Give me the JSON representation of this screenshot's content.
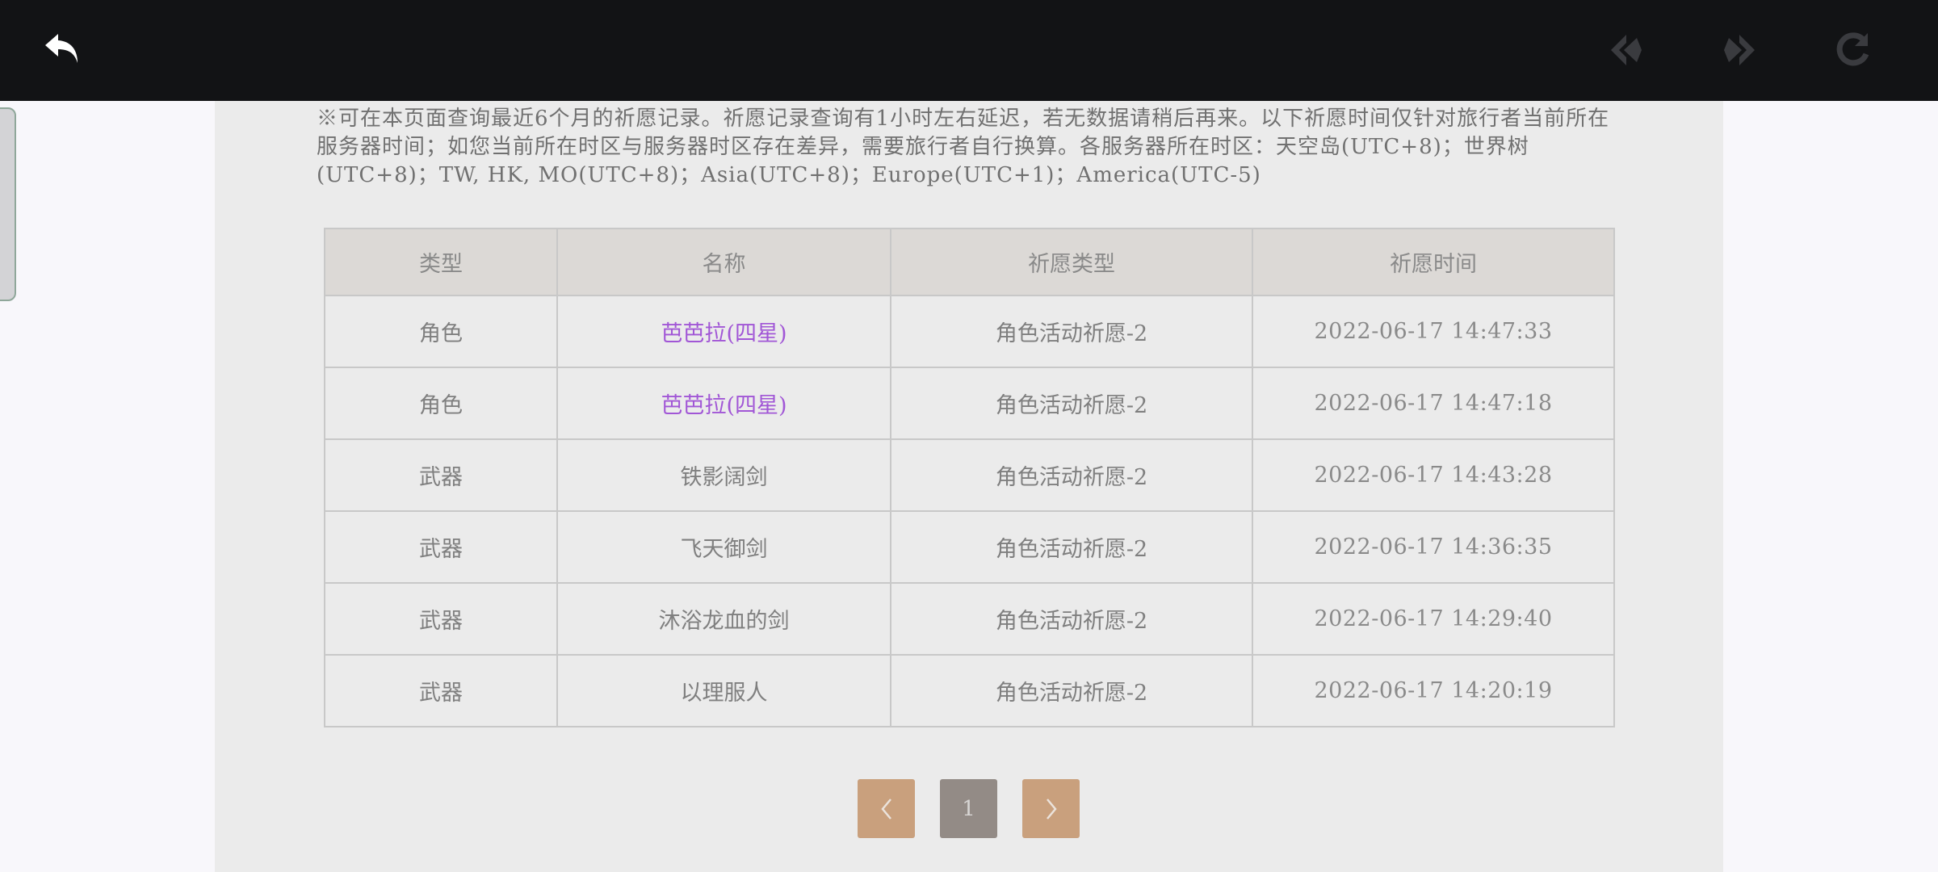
{
  "toolbar": {
    "back_icon": "back-arrow-icon",
    "prev_icon": "nav-back-diamond-icon",
    "next_icon": "nav-forward-diamond-icon",
    "refresh_icon": "refresh-icon"
  },
  "notice": "※可在本页面查询最近6个月的祈愿记录。祈愿记录查询有1小时左右延迟，若无数据请稍后再来。以下祈愿时间仅针对旅行者当前所在服务器时间；如您当前所在时区与服务器时区存在差异，需要旅行者自行换算。各服务器所在时区：天空岛(UTC+8)；世界树(UTC+8)；TW, HK, MO(UTC+8)；Asia(UTC+8)；Europe(UTC+1)；America(UTC-5)",
  "table": {
    "headers": [
      "类型",
      "名称",
      "祈愿类型",
      "祈愿时间"
    ],
    "rows": [
      {
        "type": "角色",
        "name": "芭芭拉(四星)",
        "wish": "角色活动祈愿-2",
        "time": "2022-06-17 14:47:33"
      },
      {
        "type": "角色",
        "name": "芭芭拉(四星)",
        "wish": "角色活动祈愿-2",
        "time": "2022-06-17 14:47:18"
      },
      {
        "type": "武器",
        "name": "铁影阔剑",
        "wish": "角色活动祈愿-2",
        "time": "2022-06-17 14:43:28"
      },
      {
        "type": "武器",
        "name": "飞天御剑",
        "wish": "角色活动祈愿-2",
        "time": "2022-06-17 14:36:35"
      },
      {
        "type": "武器",
        "name": "沐浴龙血的剑",
        "wish": "角色活动祈愿-2",
        "time": "2022-06-17 14:29:40"
      },
      {
        "type": "武器",
        "name": "以理服人",
        "wish": "角色活动祈愿-2",
        "time": "2022-06-17 14:20:19"
      }
    ]
  },
  "pagination": {
    "prev": "‹",
    "current": "1",
    "next": "›"
  },
  "colors": {
    "topbar": "#121315",
    "panel": "#ebebeb",
    "header_bg": "#dcd9d6",
    "four_star": "#a156d6",
    "pager_nav": "#c9a07d",
    "pager_current": "#938b86"
  }
}
